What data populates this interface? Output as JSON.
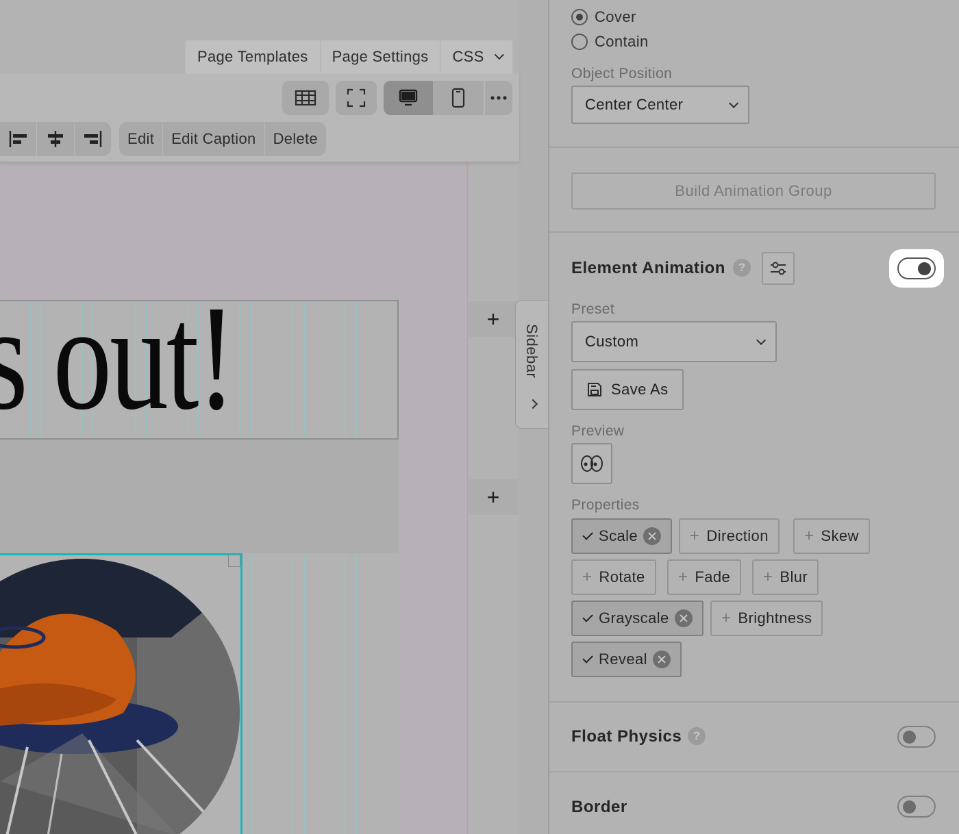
{
  "top_tabs": {
    "page_templates": "Page Templates",
    "page_settings": "Page Settings",
    "css": "CSS"
  },
  "toolbar": {
    "actions": {
      "edit": "Edit",
      "edit_caption": "Edit Caption",
      "delete": "Delete"
    },
    "view_icons": [
      "film-icon",
      "fullscreen-icon",
      "desktop-icon",
      "mobile-icon",
      "more-icon"
    ],
    "active_view": "desktop"
  },
  "canvas": {
    "headline": "s out!",
    "plus_symbol": "+",
    "sidebar_tab_label": "Sidebar",
    "accent_color": "#18b6b6"
  },
  "panel": {
    "object_fit": {
      "options": [
        "Cover",
        "Contain"
      ],
      "selected": "Cover"
    },
    "object_position": {
      "label": "Object Position",
      "value": "Center Center"
    },
    "build_animation_group": "Build Animation Group",
    "element_animation": {
      "title": "Element Animation",
      "help": "?",
      "enabled": true,
      "preset_label": "Preset",
      "preset_value": "Custom",
      "save_as": "Save As",
      "preview_label": "Preview",
      "properties_label": "Properties",
      "properties": {
        "scale": "Scale",
        "direction": "Direction",
        "skew": "Skew",
        "rotate": "Rotate",
        "fade": "Fade",
        "blur": "Blur",
        "grayscale": "Grayscale",
        "brightness": "Brightness",
        "reveal": "Reveal"
      },
      "active_properties": [
        "Scale",
        "Grayscale",
        "Reveal"
      ]
    },
    "float_physics": {
      "title": "Float Physics",
      "help": "?",
      "enabled": false
    },
    "border": {
      "title": "Border",
      "enabled": false
    }
  }
}
